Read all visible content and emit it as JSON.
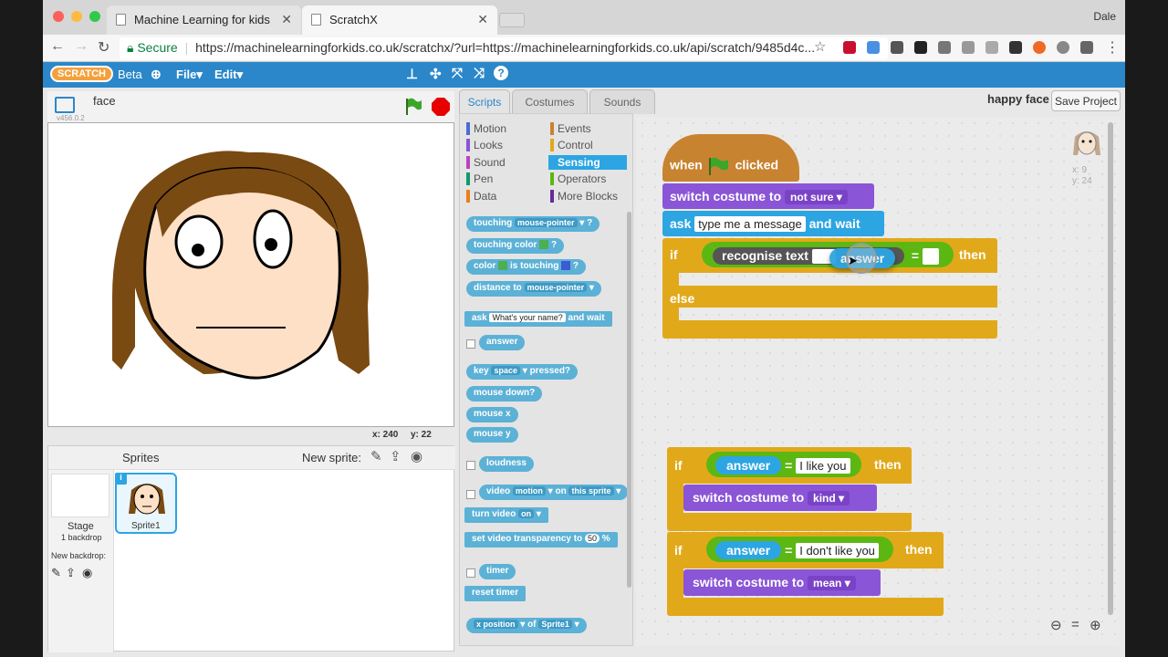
{
  "browser": {
    "tabs": [
      {
        "label": "Machine Learning for kids"
      },
      {
        "label": "ScratchX"
      }
    ],
    "user": "Dale",
    "secure_label": "Secure",
    "url": "https://machinelearningforkids.co.uk/scratchx/?url=https://machinelearningforkids.co.uk/api/scratch/9485d4c..."
  },
  "menubar": {
    "logo": "SCRATCH",
    "beta": "Beta",
    "file": "File",
    "edit": "Edit"
  },
  "stage": {
    "sprite_name": "face",
    "version": "v456.0.2",
    "x_label": "x: 240",
    "y_label": "y: 22"
  },
  "sprites": {
    "title": "Sprites",
    "new_sprite": "New sprite:",
    "stage_label": "Stage",
    "stage_sub": "1 backdrop",
    "new_backdrop": "New backdrop:",
    "sprite1": "Sprite1"
  },
  "tabs": {
    "scripts": "Scripts",
    "costumes": "Costumes",
    "sounds": "Sounds"
  },
  "project": {
    "name": "happy face",
    "save": "Save Project"
  },
  "categories": [
    {
      "label": "Motion",
      "color": "#4a6cd4"
    },
    {
      "label": "Events",
      "color": "#c88330"
    },
    {
      "label": "Looks",
      "color": "#8a55d7"
    },
    {
      "label": "Control",
      "color": "#e1a91a"
    },
    {
      "label": "Sound",
      "color": "#bb42c3"
    },
    {
      "label": "Sensing",
      "color": "#2ca5e2"
    },
    {
      "label": "Pen",
      "color": "#0e9a6c"
    },
    {
      "label": "Operators",
      "color": "#5cb712"
    },
    {
      "label": "Data",
      "color": "#ee7d16"
    },
    {
      "label": "More Blocks",
      "color": "#632d99"
    }
  ],
  "palette": {
    "touching": "touching",
    "mouse_pointer": "mouse-pointer",
    "q": "?",
    "touching_color": "touching color",
    "color": "color",
    "is_touching": "is touching",
    "distance_to": "distance to",
    "ask": "ask",
    "ask_default": "What's your name?",
    "and_wait": "and wait",
    "answer": "answer",
    "key": "key",
    "space": "space",
    "pressed": "pressed?",
    "mouse_down": "mouse down?",
    "mouse_x": "mouse x",
    "mouse_y": "mouse y",
    "loudness": "loudness",
    "video": "video",
    "motion": "motion",
    "on": "on",
    "this_sprite": "this sprite",
    "turn_video": "turn video",
    "on_opt": "on",
    "set_transparency": "set video transparency to",
    "transparency_val": "50",
    "pct": "%",
    "timer": "timer",
    "reset_timer": "reset timer",
    "x_position": "x position",
    "of": "of",
    "sprite1": "Sprite1"
  },
  "script1": {
    "when": "when",
    "clicked": "clicked",
    "switch_costume": "switch costume to",
    "costume1": "not sure",
    "ask": "ask",
    "ask_text": "type me a message",
    "and_wait": "and wait",
    "if": "if",
    "recognise_text": "recognise text",
    "drag_answer": "answer",
    "eq": "=",
    "then": "then",
    "else": "else"
  },
  "script2": {
    "if": "if",
    "answer": "answer",
    "eq": "=",
    "val": "I like you",
    "then": "then",
    "switch_costume": "switch costume to",
    "costume": "kind"
  },
  "script3": {
    "if": "if",
    "answer": "answer",
    "eq": "=",
    "val": "I don't like you",
    "then": "then",
    "switch_costume": "switch costume to",
    "costume": "mean"
  },
  "sprite_info": {
    "x": "x: 9",
    "y": "y: 24"
  }
}
